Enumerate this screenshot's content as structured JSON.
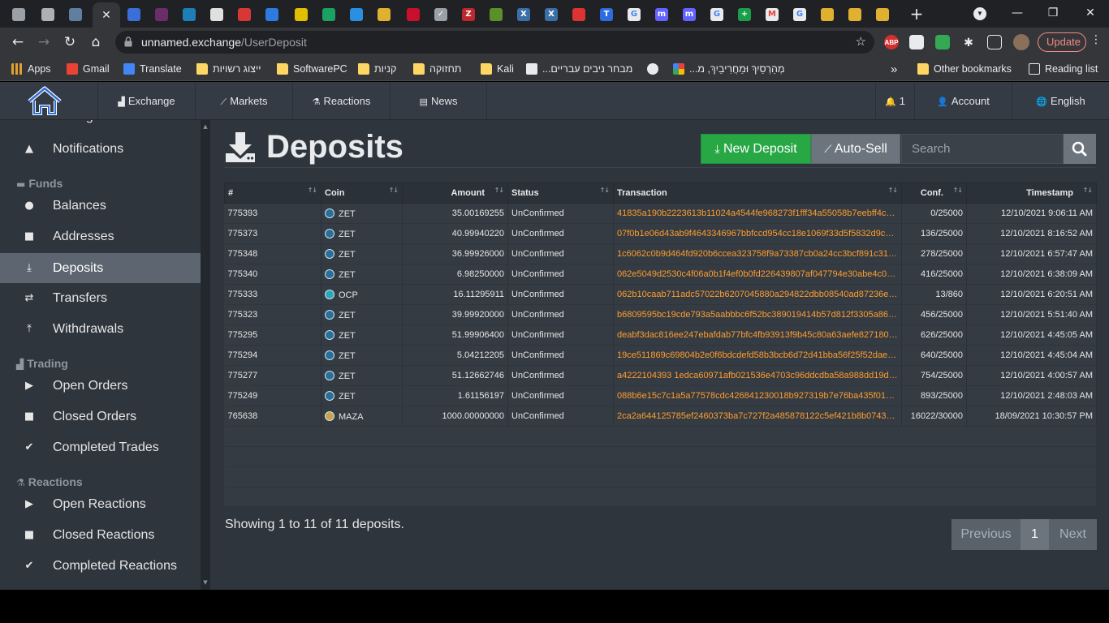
{
  "browser": {
    "tabs": [
      {
        "icon": "page-icon",
        "color": "#9aa0a6",
        "glyph": ""
      },
      {
        "icon": "photo-icon",
        "color": "#b0b0b0",
        "glyph": ""
      },
      {
        "icon": "window-icon",
        "color": "#5f7ea0",
        "glyph": ""
      },
      {
        "icon": "close-icon",
        "color": "#35363a",
        "glyph": "✕",
        "active": true
      },
      {
        "icon": "house-icon",
        "color": "#3b6fd8",
        "glyph": ""
      },
      {
        "icon": "avatar-icon",
        "color": "#6a2d6a",
        "glyph": ""
      },
      {
        "icon": "swirl-icon",
        "color": "#1e7fb8",
        "glyph": ""
      },
      {
        "icon": "soccer-icon",
        "color": "#e0e0e0",
        "glyph": ""
      },
      {
        "icon": "stack-icon",
        "color": "#d93636",
        "glyph": ""
      },
      {
        "icon": "circle-icon",
        "color": "#2d7be0",
        "glyph": ""
      },
      {
        "icon": "face-icon",
        "color": "#e0c000",
        "glyph": ""
      },
      {
        "icon": "play-icon",
        "color": "#1aa260",
        "glyph": ""
      },
      {
        "icon": "wing-icon",
        "color": "#2a8fe0",
        "glyph": ""
      },
      {
        "icon": "coin-icon",
        "color": "#e0b030",
        "glyph": ""
      },
      {
        "icon": "sushi-icon",
        "color": "#c8102e",
        "glyph": ""
      },
      {
        "icon": "check-icon",
        "color": "#9aa0a6",
        "glyph": "✓"
      },
      {
        "icon": "z-icon",
        "color": "#c0272d",
        "glyph": "Z"
      },
      {
        "icon": "zero-icon",
        "color": "#5a8f29",
        "glyph": ""
      },
      {
        "icon": "x-icon",
        "color": "#3b6fa8",
        "glyph": "X"
      },
      {
        "icon": "x-icon",
        "color": "#3b6fa8",
        "glyph": "X"
      },
      {
        "icon": "badge-icon",
        "color": "#d33",
        "glyph": ""
      },
      {
        "icon": "t-icon",
        "color": "#2d6be0",
        "glyph": "T"
      },
      {
        "icon": "google-icon",
        "color": "#e8eaed",
        "glyph": "G"
      },
      {
        "icon": "m-icon",
        "color": "#6364ff",
        "glyph": "m"
      },
      {
        "icon": "m-icon",
        "color": "#6364ff",
        "glyph": "m"
      },
      {
        "icon": "google-icon",
        "color": "#e8eaed",
        "glyph": "G"
      },
      {
        "icon": "plus-icon",
        "color": "#1a9e4a",
        "glyph": "+"
      },
      {
        "icon": "gmail-icon",
        "color": "#e8eaed",
        "glyph": "M"
      },
      {
        "icon": "google-icon",
        "color": "#e8eaed",
        "glyph": "G"
      },
      {
        "icon": "coin-icon",
        "color": "#e0b030",
        "glyph": ""
      },
      {
        "icon": "coin-icon",
        "color": "#e0b030",
        "glyph": ""
      },
      {
        "icon": "coin-icon",
        "color": "#e0b030",
        "glyph": ""
      }
    ],
    "url_domain": "unnamed.exchange",
    "url_path": "/UserDeposit",
    "update_label": "Update",
    "bookmarks": [
      {
        "label": "Apps",
        "icon": "apps-icon"
      },
      {
        "label": "Gmail",
        "icon": "gmail-icon"
      },
      {
        "label": "Translate",
        "icon": "translate-icon"
      },
      {
        "label": "ייצוג רשויות",
        "icon": "folder-icon"
      },
      {
        "label": "SoftwarePC",
        "icon": "folder-icon"
      },
      {
        "label": "קניות",
        "icon": "folder-icon"
      },
      {
        "label": "תחזוקה",
        "icon": "folder-icon"
      },
      {
        "label": "Kali",
        "icon": "folder-icon"
      },
      {
        "label": "...מבחר ניבים עבריים",
        "icon": "doc-icon"
      },
      {
        "label": "",
        "icon": "globe-icon"
      },
      {
        "label": "...מְהַרְסַיִךְ וּמַחֲרִיבַיִךְ, מ",
        "icon": "grid-icon"
      }
    ],
    "other_bookmarks": "Other bookmarks",
    "reading_list": "Reading list",
    "overflow": "»"
  },
  "site": {
    "nav": {
      "exchange": "Exchange",
      "markets": "Markets",
      "reactions": "Reactions",
      "news": "News",
      "notifications_count": "1",
      "account": "Account",
      "language": "English"
    },
    "sidebar": {
      "settings_partial": "Settings",
      "notifications": "Notifications",
      "funds_head": "Funds",
      "balances": "Balances",
      "addresses": "Addresses",
      "deposits": "Deposits",
      "transfers": "Transfers",
      "withdrawals": "Withdrawals",
      "trading_head": "Trading",
      "open_orders": "Open Orders",
      "closed_orders": "Closed Orders",
      "completed_trades": "Completed Trades",
      "reactions_head": "Reactions",
      "open_reactions": "Open Reactions",
      "closed_reactions": "Closed Reactions",
      "completed_reactions": "Completed Reactions"
    },
    "page": {
      "title": "Deposits",
      "new_deposit": "New Deposit",
      "auto_sell": "Auto-Sell",
      "search_placeholder": "Search"
    },
    "table": {
      "columns": [
        "#",
        "Coin",
        "Amount",
        "Status",
        "Transaction",
        "Conf.",
        "Timestamp"
      ],
      "rows": [
        {
          "id": "775393",
          "coin": "ZET",
          "coin_color": "#2a6f9a",
          "amount": "35.00169255",
          "status": "UnConfirmed",
          "tx": "41835a190b2223613b11024a4544fe968273f1fff34a55058b7eebff4c1...",
          "conf": "0/25000",
          "ts": "12/10/2021 9:06:11 AM"
        },
        {
          "id": "775373",
          "coin": "ZET",
          "coin_color": "#2a6f9a",
          "amount": "40.99940220",
          "status": "UnConfirmed",
          "tx": "07f0b1e06d43ab9f4643346967bbfccd954cc18e1069f33d5f5832d9c44...",
          "conf": "136/25000",
          "ts": "12/10/2021 8:16:52 AM"
        },
        {
          "id": "775348",
          "coin": "ZET",
          "coin_color": "#2a6f9a",
          "amount": "36.99926000",
          "status": "UnConfirmed",
          "tx": "1c6062c0b9d464fd920b6ccea323758f9a73387cb0a24cc3bcf891c31f3...",
          "conf": "278/25000",
          "ts": "12/10/2021 6:57:47 AM"
        },
        {
          "id": "775340",
          "coin": "ZET",
          "coin_color": "#2a6f9a",
          "amount": "6.98250000",
          "status": "UnConfirmed",
          "tx": "062e5049d2530c4f06a0b1f4ef0b0fd226439807af047794e30abe4c04d...",
          "conf": "416/25000",
          "ts": "12/10/2021 6:38:09 AM"
        },
        {
          "id": "775333",
          "coin": "OCP",
          "coin_color": "#2aa7b8",
          "amount": "16.11295911",
          "status": "UnConfirmed",
          "tx": "062b10caab711adc57022b6207045880a294822dbb08540ad87236e5...",
          "conf": "13/860",
          "ts": "12/10/2021 6:20:51 AM"
        },
        {
          "id": "775323",
          "coin": "ZET",
          "coin_color": "#2a6f9a",
          "amount": "39.99920000",
          "status": "UnConfirmed",
          "tx": "b6809595bc19cde793a5aabbbc6f52bc389019414b57d812f3305a86ca...",
          "conf": "456/25000",
          "ts": "12/10/2021 5:51:40 AM"
        },
        {
          "id": "775295",
          "coin": "ZET",
          "coin_color": "#2a6f9a",
          "amount": "51.99906400",
          "status": "UnConfirmed",
          "tx": "deabf3dac816ee247ebafdab77bfc4fb93913f9b45c80a63aefe8271809...",
          "conf": "626/25000",
          "ts": "12/10/2021 4:45:05 AM"
        },
        {
          "id": "775294",
          "coin": "ZET",
          "coin_color": "#2a6f9a",
          "amount": "5.04212205",
          "status": "UnConfirmed",
          "tx": "19ce511869c69804b2e0f6bdcdefd58b3bcb6d72d41bba56f25f52dae1...",
          "conf": "640/25000",
          "ts": "12/10/2021 4:45:04 AM"
        },
        {
          "id": "775277",
          "coin": "ZET",
          "coin_color": "#2a6f9a",
          "amount": "51.12662746",
          "status": "UnConfirmed",
          "tx": "a4222104393 1edca60971afb021536e4703c96ddcdba58a988dd19d35...",
          "conf": "754/25000",
          "ts": "12/10/2021 4:00:57 AM"
        },
        {
          "id": "775249",
          "coin": "ZET",
          "coin_color": "#2a6f9a",
          "amount": "1.61156197",
          "status": "UnConfirmed",
          "tx": "088b6e15c7c1a5a77578cdc426841230018b927319b7e76ba435f019fb...",
          "conf": "893/25000",
          "ts": "12/10/2021 2:48:03 AM"
        },
        {
          "id": "765638",
          "coin": "MAZA",
          "coin_color": "#c9a34a",
          "amount": "1000.00000000",
          "status": "UnConfirmed",
          "tx": "2ca2a644125785ef2460373ba7c727f2a485878122c5ef421b8b07431e...",
          "conf": "16022/30000",
          "ts": "18/09/2021 10:30:57 PM"
        }
      ]
    },
    "summary": "Showing 1 to 11 of 11 deposits.",
    "pager": {
      "previous": "Previous",
      "current": "1",
      "next": "Next"
    },
    "colors": {
      "accent_green": "#28a745",
      "tx_orange": "#ff9d2e",
      "bg": "#2f353d",
      "header": "#343b44"
    }
  }
}
